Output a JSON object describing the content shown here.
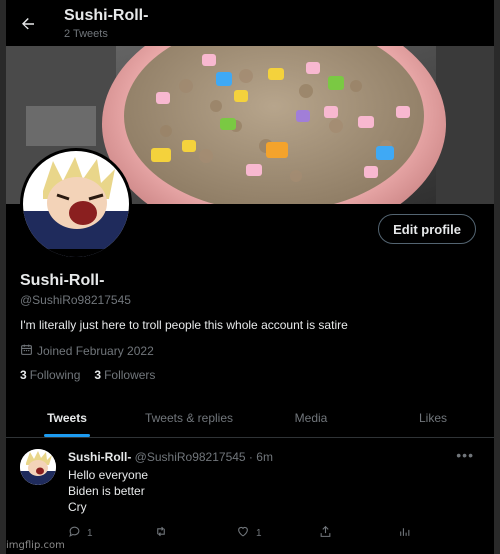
{
  "header": {
    "title": "Sushi-Roll-",
    "tweet_count": "2 Tweets"
  },
  "profile": {
    "name": "Sushi-Roll-",
    "handle": "@SushiRo98217545",
    "bio": "I'm literally just here to troll people this whole account is satire",
    "joined": "Joined February 2022",
    "following_count": "3",
    "following_label": "Following",
    "followers_count": "3",
    "followers_label": "Followers",
    "edit_label": "Edit profile"
  },
  "tabs": [
    {
      "label": "Tweets",
      "active": true
    },
    {
      "label": "Tweets & replies",
      "active": false
    },
    {
      "label": "Media",
      "active": false
    },
    {
      "label": "Likes",
      "active": false
    }
  ],
  "tweet": {
    "author": "Sushi-Roll-",
    "handle_time": "@SushiRo98217545 · 6m",
    "lines": [
      "Hello everyone",
      "Biden is better",
      "Cry"
    ],
    "reply_count": "1",
    "like_count": "1"
  },
  "watermark": "imgflip.com",
  "colors": {
    "background": "#000000",
    "accent": "#1d9bf0",
    "muted": "#71767b",
    "text": "#e7e9ea"
  }
}
